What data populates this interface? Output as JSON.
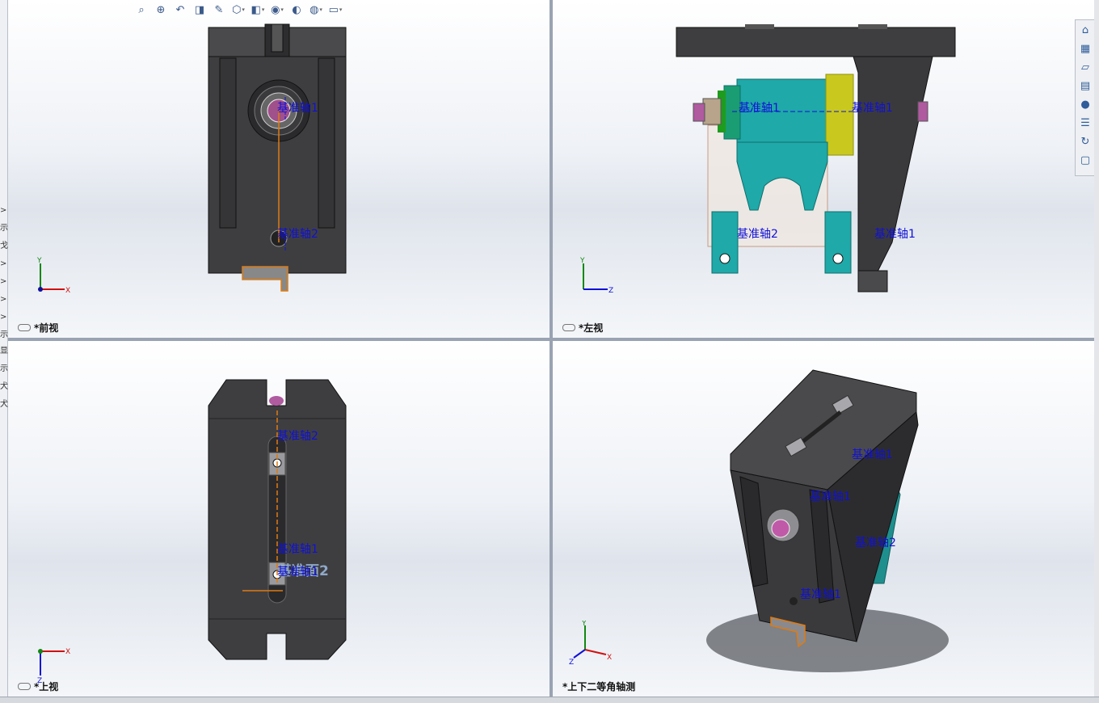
{
  "left_panel": {
    "glyphs": [
      ">",
      "示",
      "戈",
      ">",
      ">",
      ">",
      ">",
      "示",
      "显",
      "示",
      "犬",
      "犬"
    ]
  },
  "toolbar": {
    "icons": [
      "zoom-to-fit-icon",
      "zoom-area-icon",
      "previous-view-icon",
      "section-view-icon",
      "dynamic-annotation-icon",
      "view-orientation-icon",
      "display-style-icon",
      "hide-show-icon",
      "edit-appearance-icon",
      "apply-scene-icon",
      "view-settings-icon"
    ]
  },
  "task_pane": {
    "icons": [
      "home-icon",
      "design-library-icon",
      "file-explorer-icon",
      "view-palette-icon",
      "appearances-icon",
      "custom-properties-icon",
      "resources-icon",
      "forum-icon"
    ]
  },
  "viewports": {
    "front": {
      "label": "*前视",
      "triad": {
        "x": "X",
        "y": "Y"
      },
      "annotations": {
        "a1": "基准轴1",
        "a2": "基准轴2"
      }
    },
    "left": {
      "label": "*左视",
      "triad": {
        "z": "Z",
        "y": "Y"
      },
      "annotations": {
        "a1": "基准轴1",
        "a2": "基准轴1",
        "a3": "基准轴2",
        "a4": "基准轴1"
      }
    },
    "top": {
      "label": "*上视",
      "triad": {
        "x": "X",
        "z": "Z"
      },
      "annotations": {
        "a1": "基准轴2",
        "a2": "基准轴1",
        "a3": "基准轴1",
        "plane": "基准面2"
      }
    },
    "iso": {
      "label": "*上下二等角轴测",
      "triad": {
        "x": "X",
        "y": "Y",
        "z": "Z"
      },
      "annotations": {
        "a1": "基准轴1",
        "a2": "基准轴1",
        "a3": "基准轴2",
        "a4": "基准轴1"
      }
    }
  },
  "colors": {
    "part_dark": "#3c3c3f",
    "teal": "#1fa9a8",
    "yellow": "#c8c81e",
    "axis_label": "#1010d8",
    "sketch_orange": "#e07a10"
  }
}
